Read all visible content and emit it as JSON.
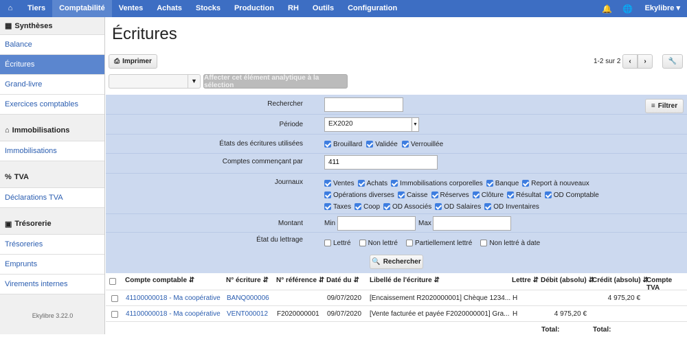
{
  "nav": {
    "home_icon": "home-icon",
    "items": [
      "Tiers",
      "Comptabilité",
      "Ventes",
      "Achats",
      "Stocks",
      "Production",
      "RH",
      "Outils",
      "Configuration"
    ],
    "active": "Comptabilité",
    "user": "Ekylibre"
  },
  "sidebar": {
    "sections": [
      {
        "title": "Synthèses",
        "icon": "table-icon",
        "items": [
          "Balance",
          "Écritures",
          "Grand-livre",
          "Exercices comptables"
        ]
      },
      {
        "title": "Immobilisations",
        "icon": "home-icon",
        "items": [
          "Immobilisations"
        ]
      },
      {
        "title": "TVA",
        "icon": "percent-icon",
        "items": [
          "Déclarations TVA"
        ]
      },
      {
        "title": "Trésorerie",
        "icon": "money-icon",
        "items": [
          "Trésoreries",
          "Emprunts",
          "Virements internes"
        ]
      }
    ],
    "active": "Écritures",
    "version": "Ekylibre 3.22.0"
  },
  "page": {
    "title": "Écritures",
    "print_label": "Imprimer",
    "pagination": "1-2 sur 2",
    "analytic_button": "Affecter cet élément analytique à la sélection",
    "filter_button": "Filtrer"
  },
  "filters": {
    "search_label": "Rechercher",
    "search_value": "",
    "period_label": "Période",
    "period_value": "EX2020",
    "states_label": "États des écritures utilisées",
    "states": [
      {
        "label": "Brouillard",
        "checked": true
      },
      {
        "label": "Validée",
        "checked": true
      },
      {
        "label": "Verrouillée",
        "checked": true
      }
    ],
    "accounts_label": "Comptes commençant par",
    "accounts_value": "411",
    "journals_label": "Journaux",
    "journals": [
      [
        {
          "label": "Ventes",
          "checked": true
        },
        {
          "label": "Achats",
          "checked": true
        },
        {
          "label": "Immobilisations corporelles",
          "checked": true
        },
        {
          "label": "Banque",
          "checked": true
        },
        {
          "label": "Report à nouveaux",
          "checked": true
        }
      ],
      [
        {
          "label": "Opérations diverses",
          "checked": true
        },
        {
          "label": "Caisse",
          "checked": true
        },
        {
          "label": "Réserves",
          "checked": true
        },
        {
          "label": "Clôture",
          "checked": true
        },
        {
          "label": "Résultat",
          "checked": true
        },
        {
          "label": "OD Comptable",
          "checked": true
        }
      ],
      [
        {
          "label": "Taxes",
          "checked": true
        },
        {
          "label": "Coop",
          "checked": true
        },
        {
          "label": "OD Associés",
          "checked": true
        },
        {
          "label": "OD Salaires",
          "checked": true
        },
        {
          "label": "OD Inventaires",
          "checked": true
        }
      ]
    ],
    "amount_label": "Montant",
    "min_label": "Min",
    "max_label": "Max",
    "lettering_label": "État du lettrage",
    "lettering": [
      {
        "label": "Lettré",
        "checked": false
      },
      {
        "label": "Non lettré",
        "checked": false
      },
      {
        "label": "Partiellement lettré",
        "checked": false
      },
      {
        "label": "Non lettré à date",
        "checked": false
      }
    ],
    "search_button": "Rechercher"
  },
  "table": {
    "headers": [
      "Compte comptable",
      "N° écriture",
      "N° référence",
      "Daté du",
      "Libellé de l'écriture",
      "Lettre",
      "Débit (absolu)",
      "Crédit (absolu)",
      "Compte TVA"
    ],
    "rows": [
      [
        "41100000018 - Ma coopérative",
        "BANQ000006",
        "",
        "09/07/2020",
        "[Encaissement R2020000001] Chèque 1234...",
        "H",
        "",
        "4 975,20 €",
        ""
      ],
      [
        "41100000018 - Ma coopérative",
        "VENT000012",
        "F2020000001",
        "09/07/2020",
        "[Vente facturée et payée F2020000001] Gra...",
        "H",
        "4 975,20 €",
        "",
        ""
      ]
    ],
    "total_label": "Total:"
  }
}
